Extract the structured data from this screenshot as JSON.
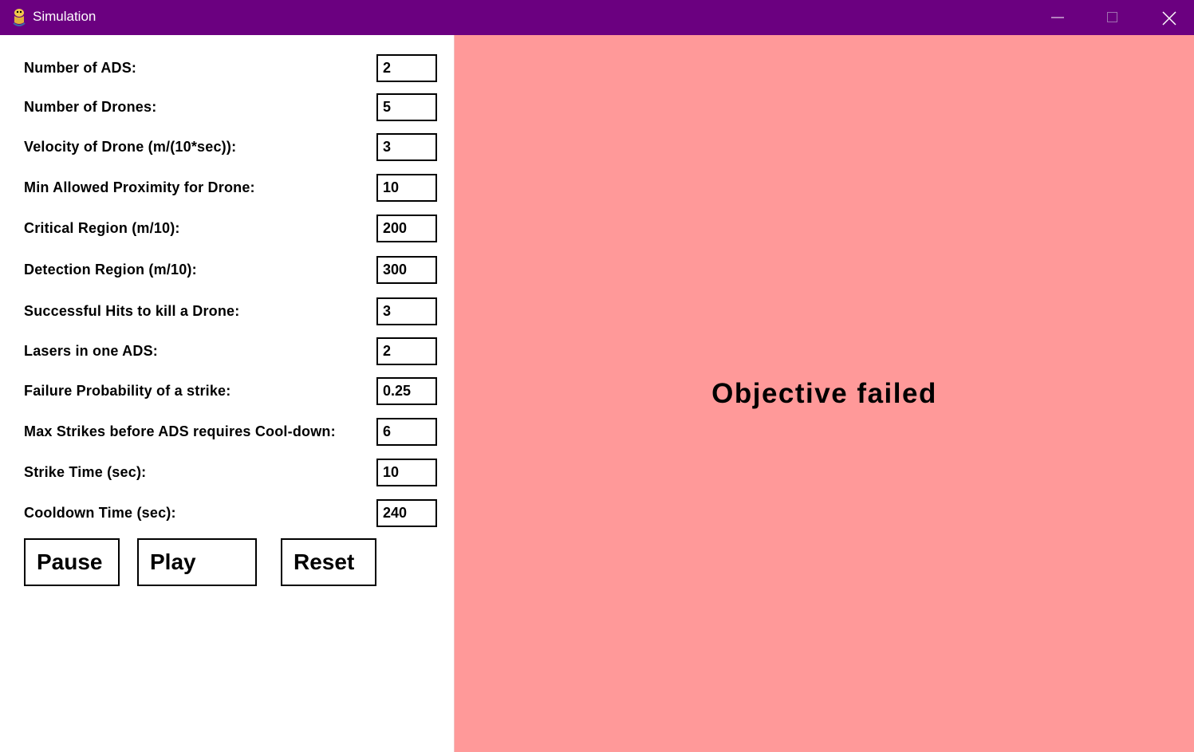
{
  "window": {
    "title": "Simulation",
    "app_icon": "python-snake-icon",
    "titlebar_color": "#6b0080"
  },
  "params": [
    {
      "label": "Number of ADS:",
      "value": "2"
    },
    {
      "label": "Number of Drones:",
      "value": "5"
    },
    {
      "label": "Velocity of Drone (m/(10*sec)):",
      "value": "3"
    },
    {
      "label": "Min Allowed Proximity for Drone:",
      "value": "10"
    },
    {
      "label": "Critical Region (m/10):",
      "value": "200"
    },
    {
      "label": "Detection Region (m/10):",
      "value": "300"
    },
    {
      "label": "Successful Hits to kill a Drone:",
      "value": "3"
    },
    {
      "label": "Lasers in one ADS:",
      "value": "2"
    },
    {
      "label": "Failure Probability of a strike:",
      "value": "0.25"
    },
    {
      "label": "Max Strikes before ADS requires Cool-down:",
      "value": "6"
    },
    {
      "label": "Strike Time (sec):",
      "value": "10"
    },
    {
      "label": "Cooldown Time (sec):",
      "value": "240"
    }
  ],
  "controls": {
    "pause_label": "Pause",
    "play_label": "Play",
    "reset_label": "Reset"
  },
  "simulation": {
    "status_text": "Objective failed",
    "background_color": "#ff9999"
  }
}
